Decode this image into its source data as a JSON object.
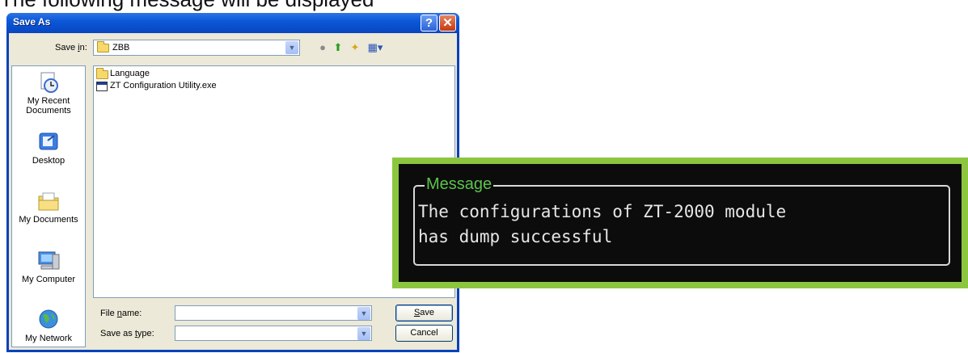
{
  "caption": "The following message will be displayed",
  "dialog": {
    "title": "Save As",
    "help_label": "?",
    "close_label": "✕",
    "save_in_prefix": "Save ",
    "save_in_hotkey": "i",
    "save_in_suffix": "n:",
    "save_in_value": "ZBB",
    "places": [
      {
        "label_line1": "My Recent",
        "label_line2": "Documents"
      },
      {
        "label_line1": "Desktop"
      },
      {
        "label_line1": "My Documents"
      },
      {
        "label_line1": "My Computer"
      },
      {
        "label_line1": "My Network"
      }
    ],
    "files": [
      {
        "name": "Language",
        "type": "folder"
      },
      {
        "name": "ZT Configuration Utility.exe",
        "type": "exe"
      }
    ],
    "file_name_prefix": "File ",
    "file_name_hotkey": "n",
    "file_name_suffix": "ame:",
    "file_name_value": "",
    "save_type_prefix": "Save as ",
    "save_type_hotkey": "t",
    "save_type_suffix": "ype:",
    "save_type_value": "",
    "save_button_hotkey": "S",
    "save_button_rest": "ave",
    "cancel_label": "Cancel"
  },
  "message": {
    "title": "Message",
    "line1": "The configurations of ZT-2000 module",
    "line2": "has dump successful"
  },
  "colors": {
    "titlebar_blue": "#0b58d8",
    "dialog_face": "#ece9d8",
    "message_border": "#8cc63f",
    "message_title": "#5cc34a",
    "terminal_bg": "#0c0c0c"
  },
  "icons": [
    "help-icon",
    "close-icon",
    "folder-icon",
    "combo-arrow-icon",
    "back-icon",
    "up-folder-icon",
    "new-folder-icon",
    "view-menu-icon",
    "my-recent-documents-icon",
    "desktop-icon",
    "my-documents-icon",
    "my-computer-icon",
    "my-network-icon",
    "exe-icon"
  ]
}
